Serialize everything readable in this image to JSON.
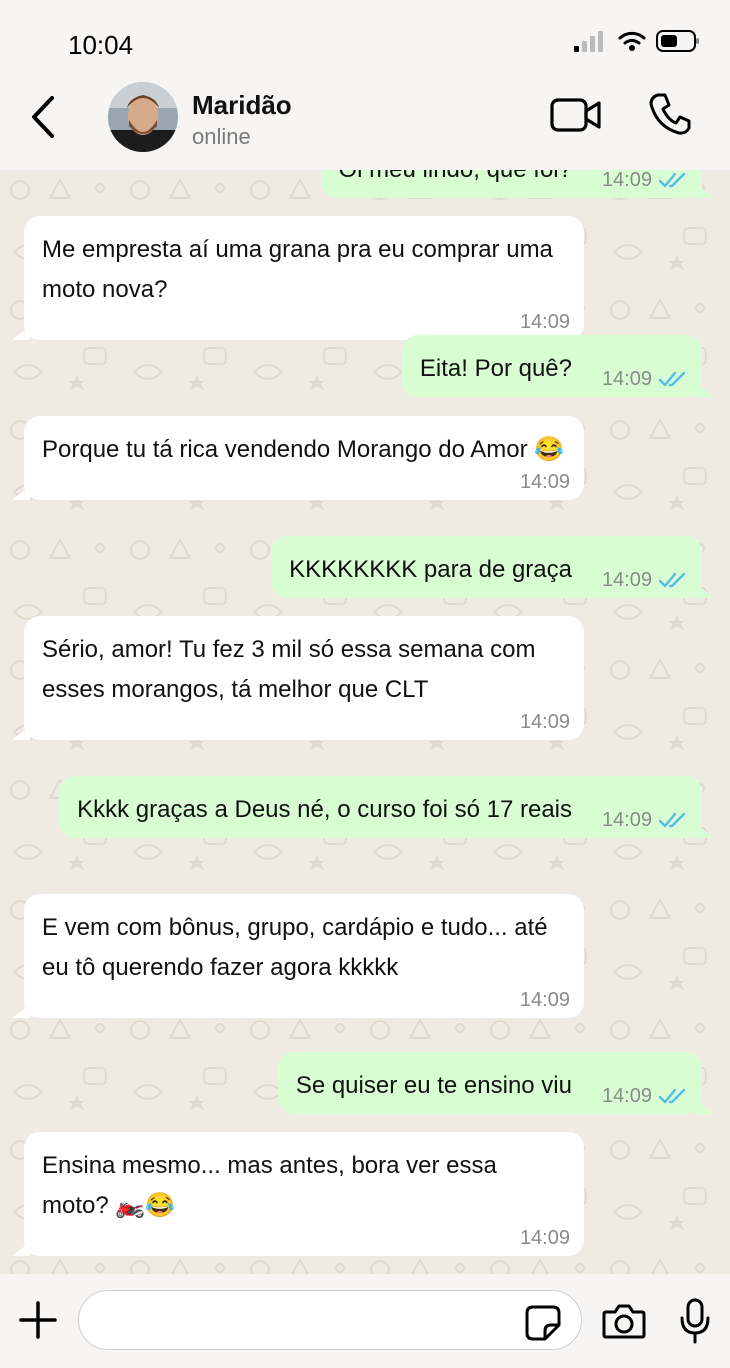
{
  "status_bar": {
    "time": "10:04"
  },
  "header": {
    "contact_name": "Maridão",
    "contact_status": "online"
  },
  "messages": [
    {
      "dir": "out",
      "text": "Oi meu lindo, que foi?",
      "time": "14:09"
    },
    {
      "dir": "in",
      "text": "Me empresta aí uma grana pra eu comprar uma moto nova?",
      "time": "14:09"
    },
    {
      "dir": "out",
      "text": "Eita! Por quê?",
      "time": "14:09"
    },
    {
      "dir": "in",
      "text": "Porque tu tá rica vendendo Morango do Amor 😂",
      "time": "14:09"
    },
    {
      "dir": "out",
      "text": "KKKKKKKK para de graça",
      "time": "14:09"
    },
    {
      "dir": "in",
      "text": "Sério, amor! Tu fez 3 mil só essa semana com esses morangos, tá melhor que CLT",
      "time": "14:09"
    },
    {
      "dir": "out",
      "text": "Kkkk graças a Deus né, o curso foi só 17 reais",
      "time": "14:09"
    },
    {
      "dir": "in",
      "text": "E vem com bônus, grupo, cardápio e tudo... até eu tô querendo fazer agora kkkkk",
      "time": "14:09"
    },
    {
      "dir": "out",
      "text": "Se quiser eu te ensino viu",
      "time": "14:09"
    },
    {
      "dir": "in",
      "text": "Ensina mesmo... mas antes, bora ver essa moto? 🏍️😂",
      "time": "14:09"
    }
  ],
  "composer": {
    "placeholder": ""
  },
  "colors": {
    "incoming": "#ffffff",
    "outgoing": "#d9fdd3",
    "read_ticks": "#53bdeb",
    "chat_bg": "#efeae2"
  },
  "icons": [
    "back-arrow-icon",
    "video-call-icon",
    "phone-icon",
    "plus-icon",
    "sticker-icon",
    "camera-icon",
    "microphone-icon",
    "read-receipt-icon",
    "signal-icon",
    "wifi-icon",
    "battery-icon"
  ]
}
